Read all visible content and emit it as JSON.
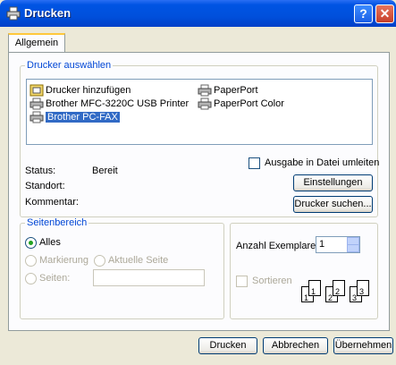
{
  "window": {
    "title": "Drucken"
  },
  "tabs": [
    {
      "label": "Allgemein"
    }
  ],
  "printer_group": {
    "title": "Drucker auswählen",
    "printers": [
      {
        "label": "Drucker hinzufügen",
        "icon": "add-printer-icon"
      },
      {
        "label": "Brother  MFC-3220C USB Printer",
        "icon": "printer-icon"
      },
      {
        "label": "Brother PC-FAX",
        "icon": "fax-printer-icon",
        "selected": true
      },
      {
        "label": "PaperPort",
        "icon": "printer-icon"
      },
      {
        "label": "PaperPort Color",
        "icon": "printer-icon"
      }
    ],
    "status_label": "Status:",
    "status_value": "Bereit",
    "location_label": "Standort:",
    "comment_label": "Kommentar:",
    "print_to_file_label": "Ausgabe in Datei umleiten",
    "preferences_button": "Einstellungen",
    "find_printer_button": "Drucker suchen..."
  },
  "page_range": {
    "title": "Seitenbereich",
    "all_label": "Alles",
    "selection_label": "Markierung",
    "current_page_label": "Aktuelle Seite",
    "pages_label": "Seiten:"
  },
  "copies": {
    "label": "Anzahl Exemplare:",
    "value": "1",
    "collate_label": "Sortieren",
    "collate_pages": [
      "1",
      "1",
      "2",
      "2",
      "3",
      "3"
    ]
  },
  "buttons": {
    "print": "Drucken",
    "cancel": "Abbrechen",
    "apply": "Übernehmen"
  },
  "colors": {
    "titlebar": "#0054e3",
    "group_title": "#0046d5",
    "selection": "#316ac5"
  }
}
